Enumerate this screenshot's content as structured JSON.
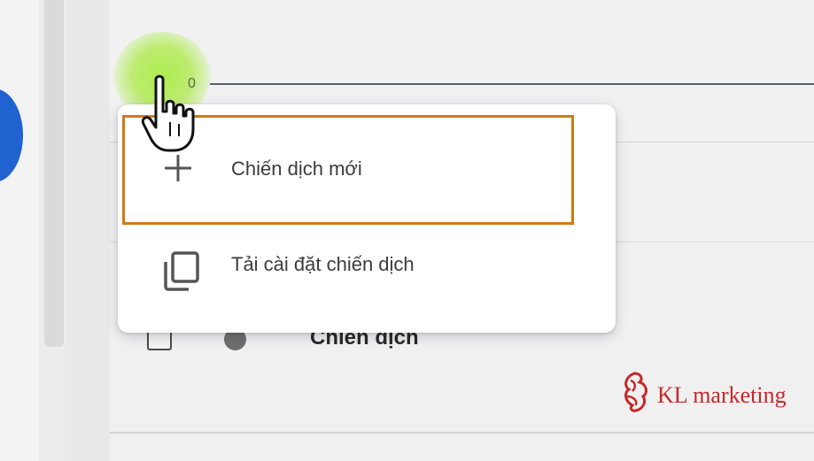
{
  "toolbar": {
    "count": "0"
  },
  "dropdown": {
    "items": [
      {
        "label": "Chiến dịch mới",
        "icon": "plus-icon"
      },
      {
        "label": "Tải cài đặt chiến dịch",
        "icon": "copy-icon"
      }
    ]
  },
  "table": {
    "column_header": "Chiến dịch"
  },
  "brand": {
    "name": "KL marketing",
    "logo_icon": "phoenix-logo-icon"
  },
  "colors": {
    "accent_highlight": "#d07a14",
    "fab_blue": "#1f62d0",
    "click_glow": "#aee846",
    "brand_red": "#c62828"
  }
}
